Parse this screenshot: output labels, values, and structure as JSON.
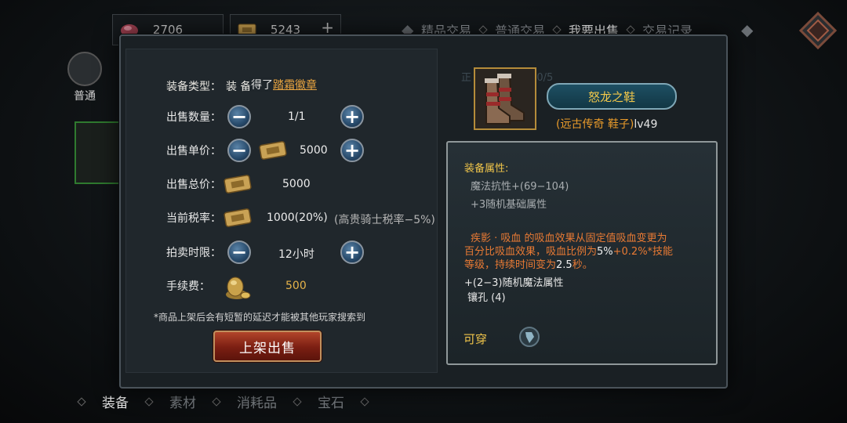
{
  "currencies": [
    {
      "value": "2706"
    },
    {
      "value": "5243",
      "plus": "+"
    }
  ],
  "top_tabs": [
    "精品交易",
    "普通交易",
    "我要出售",
    "交易记录"
  ],
  "top_tabs_active": 2,
  "left_category": {
    "label": "普通"
  },
  "bottom_tabs": [
    "装备",
    "素材",
    "消耗品",
    "宝石"
  ],
  "dialog": {
    "equip_type_label": "装备类型：",
    "equip_type_value": "装 备",
    "got_prefix": "得了",
    "got_link": "踏霜徽章",
    "rows": {
      "quantity": {
        "label": "出售数量：",
        "value": "1/1",
        "minus": "−",
        "plus": "+"
      },
      "unit_price": {
        "label": "出售单价：",
        "value": "5000",
        "minus": "−",
        "plus": "+"
      },
      "total_price": {
        "label": "出售总价：",
        "value": "5000"
      },
      "tax": {
        "label": "当前税率：",
        "value": "1000(20%)",
        "note": "(高贵骑士税率−5%)"
      },
      "duration": {
        "label": "拍卖时限：",
        "value": "12小时",
        "minus": "−",
        "plus": "+"
      },
      "fee": {
        "label": "手续费：",
        "value": "500"
      }
    },
    "notice": "*商品上架后会有短暂的延迟才能被其他玩家搜索到",
    "sell_button": "上架出售"
  },
  "item": {
    "name": "怒龙之鞋",
    "sub_quality": "(远古传奇 鞋子)",
    "sub_level": "lv49",
    "faded_text": "正 (远古 鞋子)：0/5"
  },
  "attributes": {
    "title": "装备属性:",
    "lines": [
      "魔法抗性+(69−104)",
      "+3随机基础属性"
    ],
    "special": [
      {
        "text": "疾影 · 吸血",
        "style": "orange"
      },
      {
        "text": " 的吸血效果从固定值吸血变更为百分比吸血效果，吸血比例为",
        "style": "orange"
      },
      {
        "text": "5%",
        "style": "white"
      },
      {
        "text": "+0.2%*技能等级，持续时间变为",
        "style": "orange"
      },
      {
        "text": "2.5",
        "style": "white"
      },
      {
        "text": "秒。",
        "style": "orange"
      }
    ],
    "extra": [
      "+(2−3)随机魔法属性",
      "镶孔 (4)"
    ],
    "wear_label": "可穿"
  },
  "colors": {
    "accent_gold": "#f0c54a",
    "accent_orange": "#e87a34",
    "button_red": "#b2452a",
    "button_blue": "#274a6b"
  },
  "icons": [
    "ticket-icon",
    "coin-bag-icon",
    "boots-icon",
    "gem-icon",
    "emblem-icon",
    "plus-icon",
    "minus-icon"
  ]
}
